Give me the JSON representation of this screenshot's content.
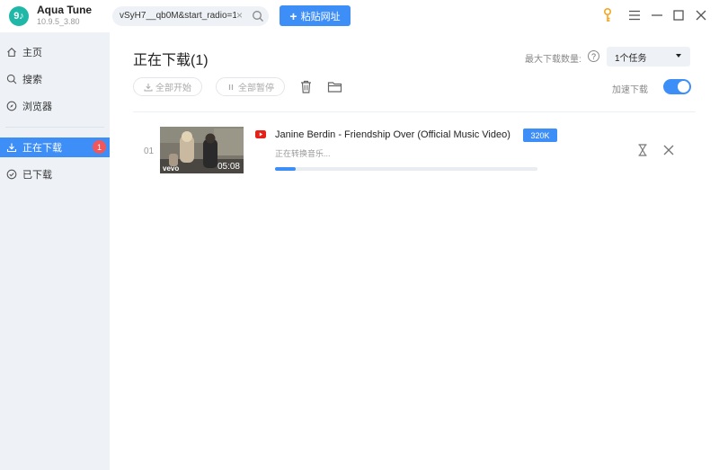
{
  "app": {
    "name": "Aqua Tune",
    "version": "10.9.5_3.80",
    "logo_text": "9♪"
  },
  "toolbar": {
    "url_value": "vSyH7__qb0M&start_radio=1",
    "paste_label": "粘贴网址"
  },
  "sidebar": {
    "items": [
      {
        "label": "主页",
        "icon": "home-icon"
      },
      {
        "label": "搜索",
        "icon": "search-icon"
      },
      {
        "label": "浏览器",
        "icon": "compass-icon"
      },
      {
        "label": "正在下载",
        "icon": "download-icon",
        "badge": "1",
        "active": true
      },
      {
        "label": "已下载",
        "icon": "check-circle-icon"
      }
    ]
  },
  "main": {
    "title": "正在下载(1)",
    "max_label": "最大下载数量:",
    "max_value": "1个任务",
    "start_all": "全部开始",
    "pause_all": "全部暂停",
    "accel_label": "加速下载",
    "accel_on": true
  },
  "downloads": [
    {
      "index": "01",
      "title": "Janine Berdin - Friendship Over (Official Music Video)",
      "quality": "320K",
      "status": "正在转换音乐...",
      "duration": "05:08",
      "brand": "vevo",
      "progress": 0.08
    }
  ],
  "colors": {
    "accent": "#3e8ef7",
    "badge": "#f0565a",
    "key": "#f5a623",
    "youtube": "#e62117"
  }
}
